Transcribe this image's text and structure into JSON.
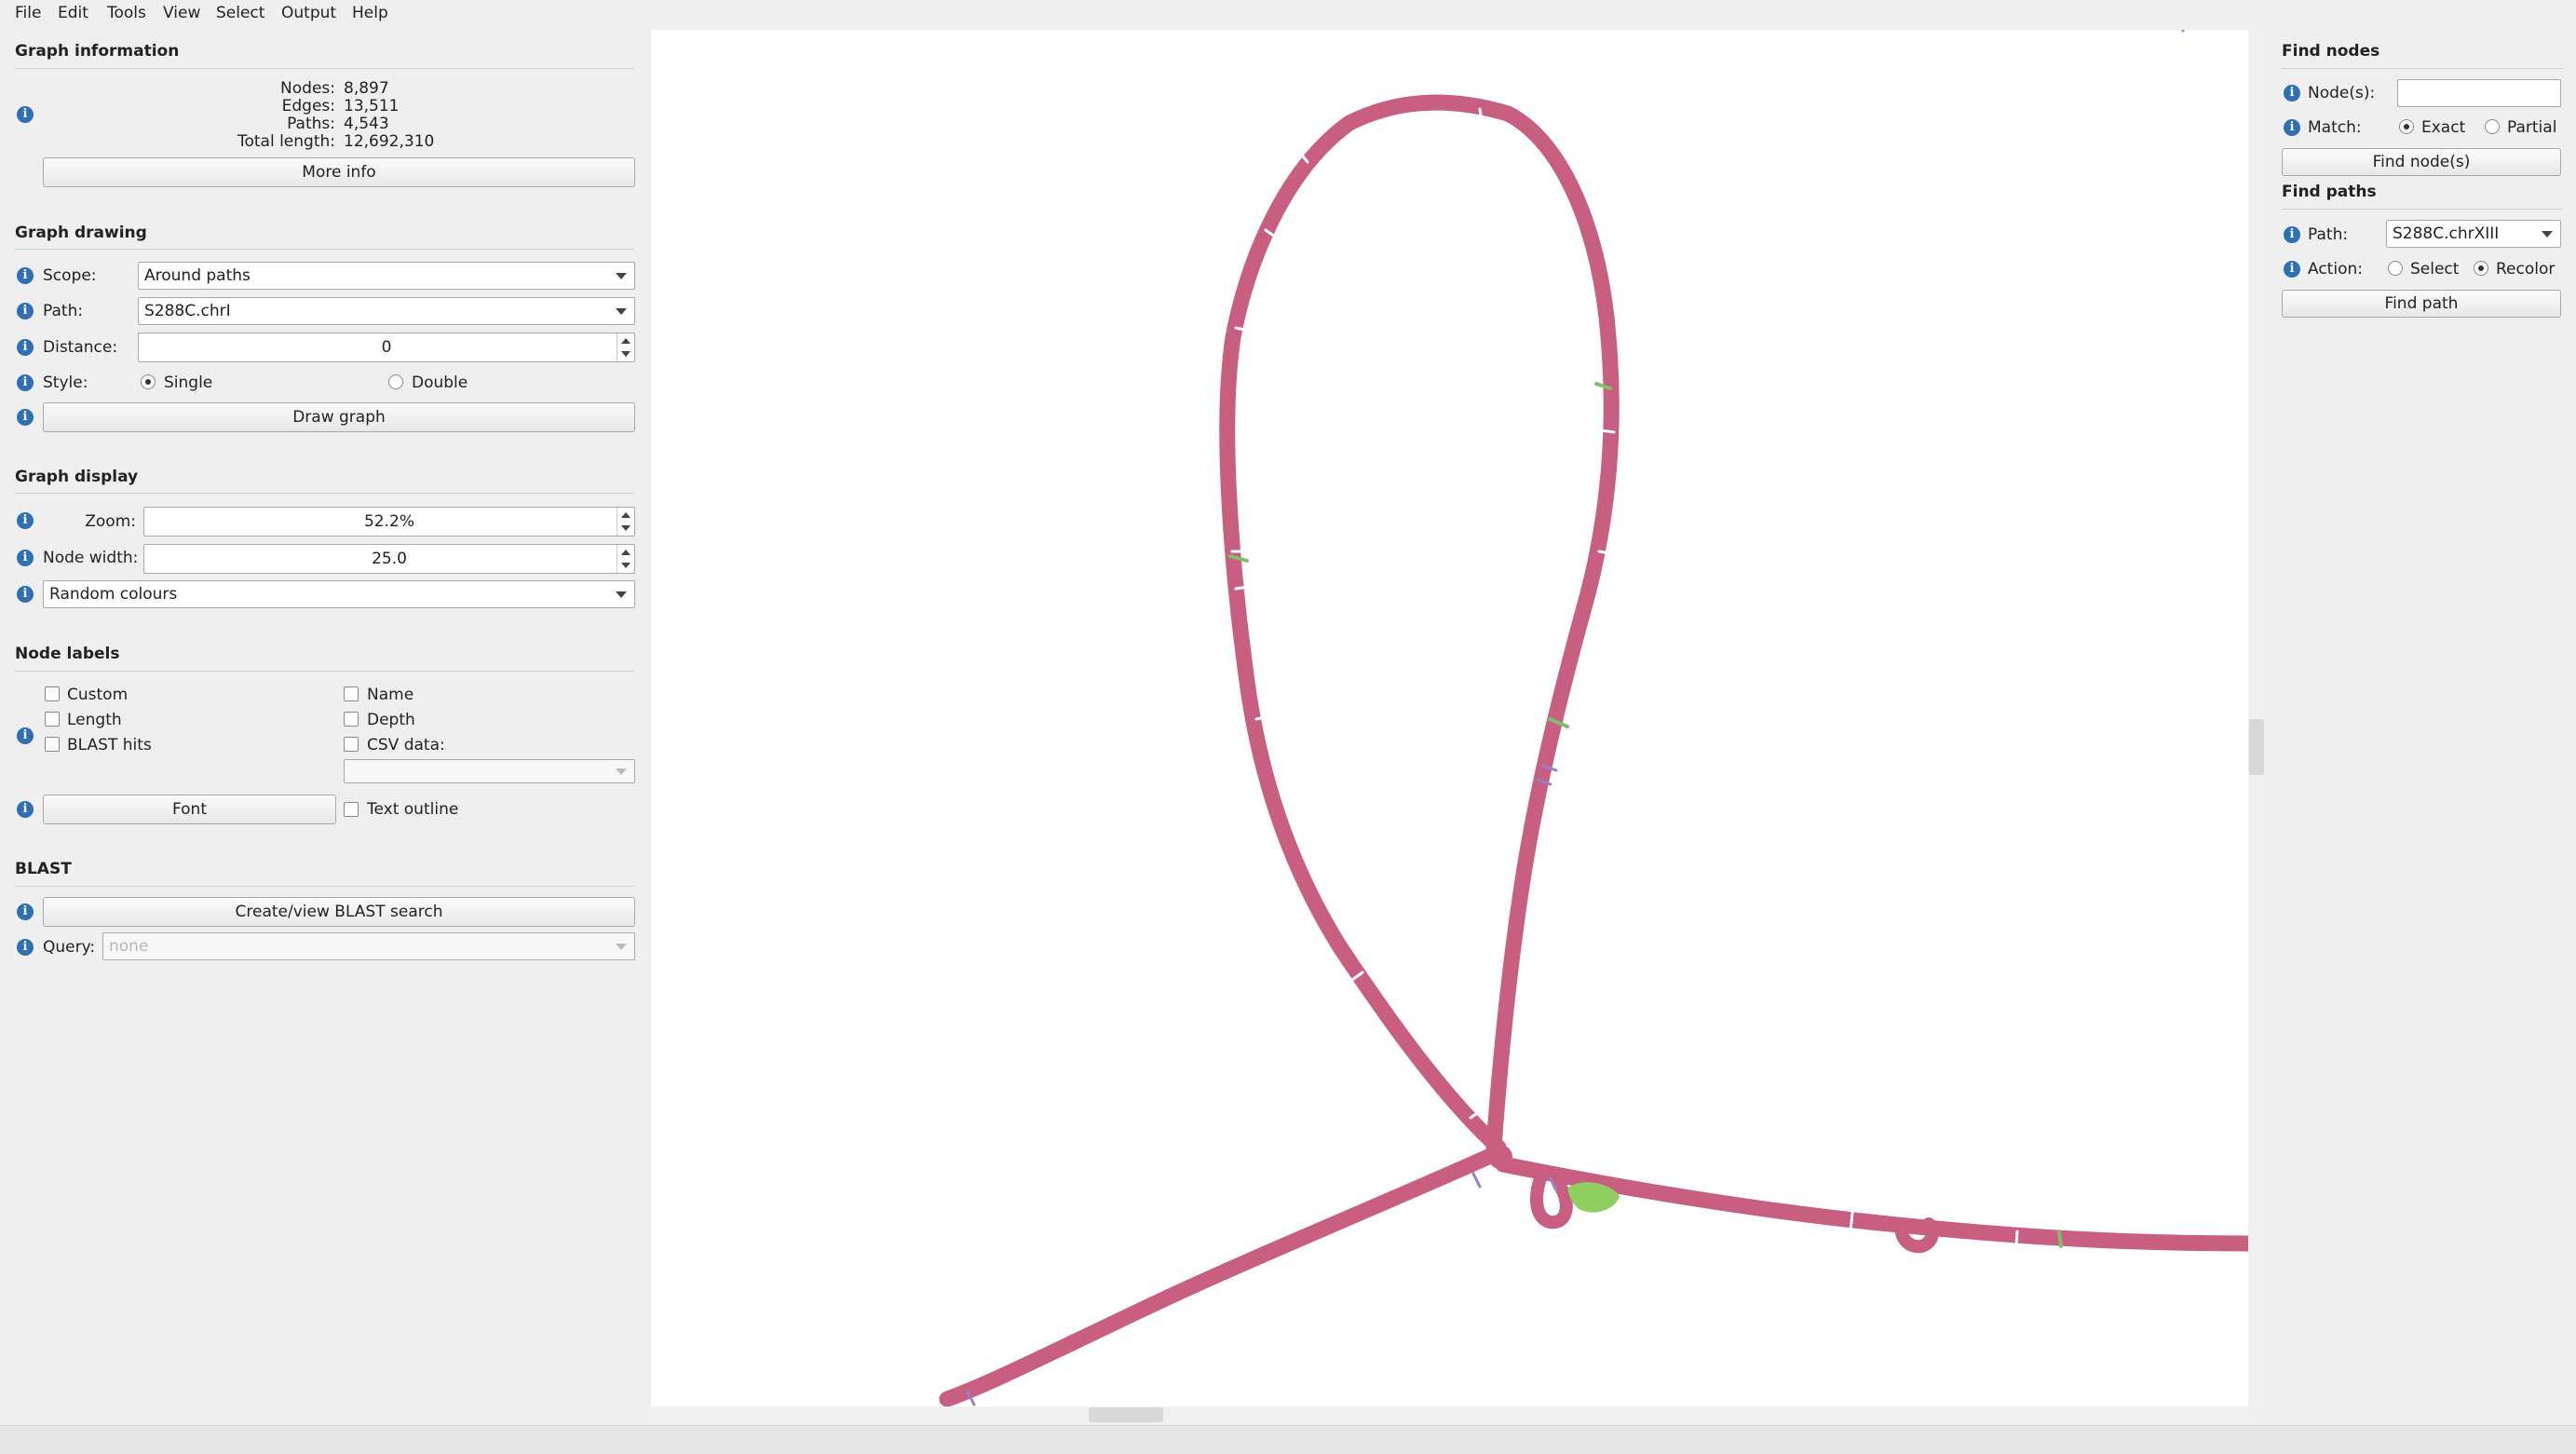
{
  "menu": [
    "File",
    "Edit",
    "Tools",
    "View",
    "Select",
    "Output",
    "Help"
  ],
  "graph_info": {
    "title": "Graph information",
    "nodes_label": "Nodes:",
    "nodes_value": "8,897",
    "edges_label": "Edges:",
    "edges_value": "13,511",
    "paths_label": "Paths:",
    "paths_value": "4,543",
    "total_label": "Total length:",
    "total_value": "12,692,310",
    "more_info_button": "More info"
  },
  "graph_drawing": {
    "title": "Graph drawing",
    "scope_label": "Scope:",
    "scope_value": "Around paths",
    "path_label": "Path:",
    "path_value": "S288C.chrI",
    "distance_label": "Distance:",
    "distance_value": "0",
    "style_label": "Style:",
    "style_single": "Single",
    "style_double": "Double",
    "draw_button": "Draw graph"
  },
  "graph_display": {
    "title": "Graph display",
    "zoom_label": "Zoom:",
    "zoom_value": "52.2%",
    "node_width_label": "Node width:",
    "node_width_value": "25.0",
    "colour_scheme": "Random colours"
  },
  "node_labels": {
    "title": "Node labels",
    "custom": "Custom",
    "name": "Name",
    "length": "Length",
    "depth": "Depth",
    "blast_hits": "BLAST hits",
    "csv_data": "CSV data:",
    "font_button": "Font",
    "text_outline": "Text outline"
  },
  "blast": {
    "title": "BLAST",
    "search_button": "Create/view BLAST search",
    "query_label": "Query:",
    "query_value": "none"
  },
  "find_nodes": {
    "title": "Find nodes",
    "nodes_label": "Node(s):",
    "nodes_value": "",
    "match_label": "Match:",
    "exact": "Exact",
    "partial": "Partial",
    "find_button": "Find node(s)"
  },
  "find_paths": {
    "title": "Find paths",
    "path_label": "Path:",
    "path_value": "S288C.chrXIII",
    "action_label": "Action:",
    "select": "Select",
    "recolor": "Recolor",
    "find_button": "Find path"
  },
  "colors": {
    "node": "#c95f80",
    "accent_green": "#8fcf5f",
    "info_icon": "#2f6fb3"
  }
}
